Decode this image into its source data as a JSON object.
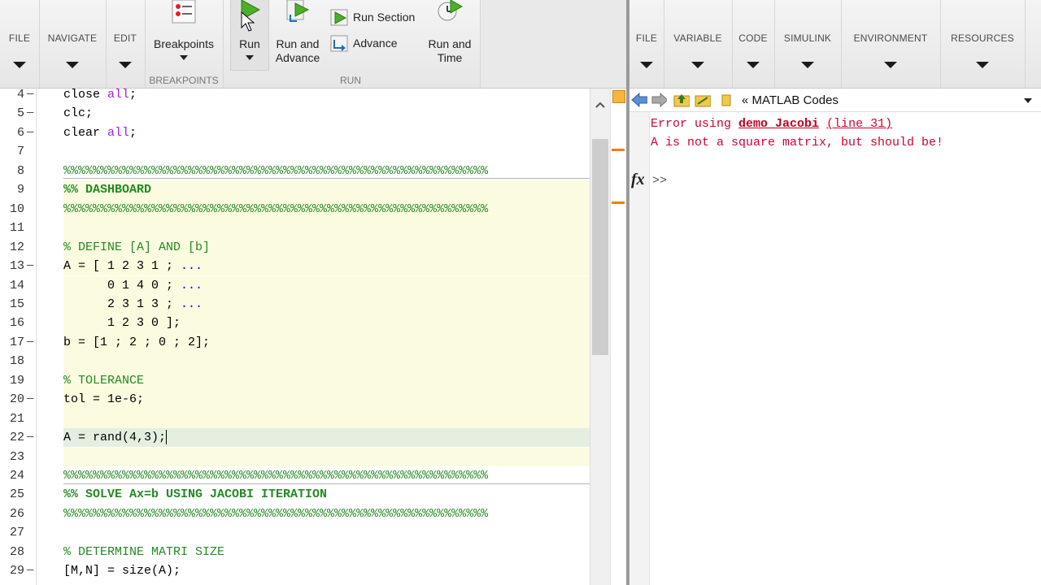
{
  "left_toolstrip": {
    "tabs": [
      {
        "label": "FILE"
      },
      {
        "label": "NAVIGATE"
      },
      {
        "label": "EDIT"
      }
    ],
    "breakpoints": {
      "label": "Breakpoints",
      "group": "BREAKPOINTS"
    },
    "run": {
      "label": "Run"
    },
    "run_advance": {
      "label_line1": "Run and",
      "label_line2": "Advance"
    },
    "run_section": {
      "label": "Run Section"
    },
    "advance": {
      "label": "Advance"
    },
    "run_time": {
      "label_line1": "Run and",
      "label_line2": "Time"
    },
    "run_group": "RUN"
  },
  "editor": {
    "lines": [
      {
        "num": "4",
        "dash": "—",
        "parts": [
          {
            "t": "close ",
            "c": ""
          },
          {
            "t": "all",
            "c": "c-str"
          },
          {
            "t": ";",
            "c": ""
          }
        ]
      },
      {
        "num": "5",
        "dash": "—",
        "parts": [
          {
            "t": "clc;",
            "c": ""
          }
        ]
      },
      {
        "num": "6",
        "dash": "—",
        "parts": [
          {
            "t": "clear ",
            "c": ""
          },
          {
            "t": "all",
            "c": "c-str"
          },
          {
            "t": ";",
            "c": ""
          }
        ]
      },
      {
        "num": "7",
        "dash": "",
        "parts": []
      },
      {
        "num": "8",
        "dash": "",
        "parts": [
          {
            "t": "%%%%%%%%%%%%%%%%%%%%%%%%%%%%%%%%%%%%%%%%%%%%%%%%%%%%%%%%%%",
            "c": "c-comment"
          }
        ]
      },
      {
        "num": "9",
        "dash": "",
        "parts": [
          {
            "t": "%% DASHBOARD",
            "c": "c-cellhdr"
          }
        ]
      },
      {
        "num": "10",
        "dash": "",
        "parts": [
          {
            "t": "%%%%%%%%%%%%%%%%%%%%%%%%%%%%%%%%%%%%%%%%%%%%%%%%%%%%%%%%%%",
            "c": "c-comment"
          }
        ]
      },
      {
        "num": "11",
        "dash": "",
        "parts": []
      },
      {
        "num": "12",
        "dash": "",
        "parts": [
          {
            "t": "% DEFINE [A] AND [b]",
            "c": "c-comment"
          }
        ]
      },
      {
        "num": "13",
        "dash": "—",
        "parts": [
          {
            "t": "A = [ 1 2 3 1 ; ",
            "c": ""
          },
          {
            "t": "...",
            "c": "c-cont"
          }
        ]
      },
      {
        "num": "14",
        "dash": "",
        "parts": [
          {
            "t": "      0 1 4 0 ; ",
            "c": ""
          },
          {
            "t": "...",
            "c": "c-cont"
          }
        ]
      },
      {
        "num": "15",
        "dash": "",
        "parts": [
          {
            "t": "      2 3 1 3 ; ",
            "c": ""
          },
          {
            "t": "...",
            "c": "c-cont"
          }
        ]
      },
      {
        "num": "16",
        "dash": "",
        "parts": [
          {
            "t": "      1 2 3 0 ];",
            "c": ""
          }
        ]
      },
      {
        "num": "17",
        "dash": "—",
        "parts": [
          {
            "t": "b = [1 ; 2 ; 0 ; 2];",
            "c": ""
          }
        ]
      },
      {
        "num": "18",
        "dash": "",
        "parts": []
      },
      {
        "num": "19",
        "dash": "",
        "parts": [
          {
            "t": "% TOLERANCE",
            "c": "c-comment"
          }
        ]
      },
      {
        "num": "20",
        "dash": "—",
        "parts": [
          {
            "t": "tol = 1e-6;",
            "c": ""
          }
        ]
      },
      {
        "num": "21",
        "dash": "",
        "parts": []
      },
      {
        "num": "22",
        "dash": "—",
        "parts": [
          {
            "t": "A = rand(4,3);",
            "c": ""
          }
        ]
      },
      {
        "num": "23",
        "dash": "",
        "parts": []
      },
      {
        "num": "24",
        "dash": "",
        "parts": [
          {
            "t": "%%%%%%%%%%%%%%%%%%%%%%%%%%%%%%%%%%%%%%%%%%%%%%%%%%%%%%%%%%",
            "c": "c-comment"
          }
        ]
      },
      {
        "num": "25",
        "dash": "",
        "parts": [
          {
            "t": "%% SOLVE Ax=b USING JACOBI ITERATION",
            "c": "c-cellhdr"
          }
        ]
      },
      {
        "num": "26",
        "dash": "",
        "parts": [
          {
            "t": "%%%%%%%%%%%%%%%%%%%%%%%%%%%%%%%%%%%%%%%%%%%%%%%%%%%%%%%%%%",
            "c": "c-comment"
          }
        ]
      },
      {
        "num": "27",
        "dash": "",
        "parts": []
      },
      {
        "num": "28",
        "dash": "",
        "parts": [
          {
            "t": "% DETERMINE MATRI SIZE",
            "c": "c-comment"
          }
        ]
      },
      {
        "num": "29",
        "dash": "—",
        "parts": [
          {
            "t": "[M,N] = size(A);",
            "c": ""
          }
        ]
      }
    ]
  },
  "right_toolstrip": {
    "tabs": [
      {
        "label": "FILE"
      },
      {
        "label": "VARIABLE"
      },
      {
        "label": "CODE"
      },
      {
        "label": "SIMULINK"
      },
      {
        "label": "ENVIRONMENT"
      },
      {
        "label": "RESOURCES"
      }
    ]
  },
  "address": {
    "path": "« MATLAB Codes"
  },
  "command_window": {
    "error_prefix": "Error using ",
    "error_func": "demo_Jacobi",
    "error_line": "(line 31)",
    "error_message": "A is not a square matrix, but should be!",
    "fx": "fx",
    "prompt": ">>"
  },
  "colors": {
    "comment": "#228b22",
    "string": "#a020f0",
    "error": "#d9002f",
    "cell_bg": "#fbfbe0",
    "current_line_bg": "#e4efe0"
  }
}
